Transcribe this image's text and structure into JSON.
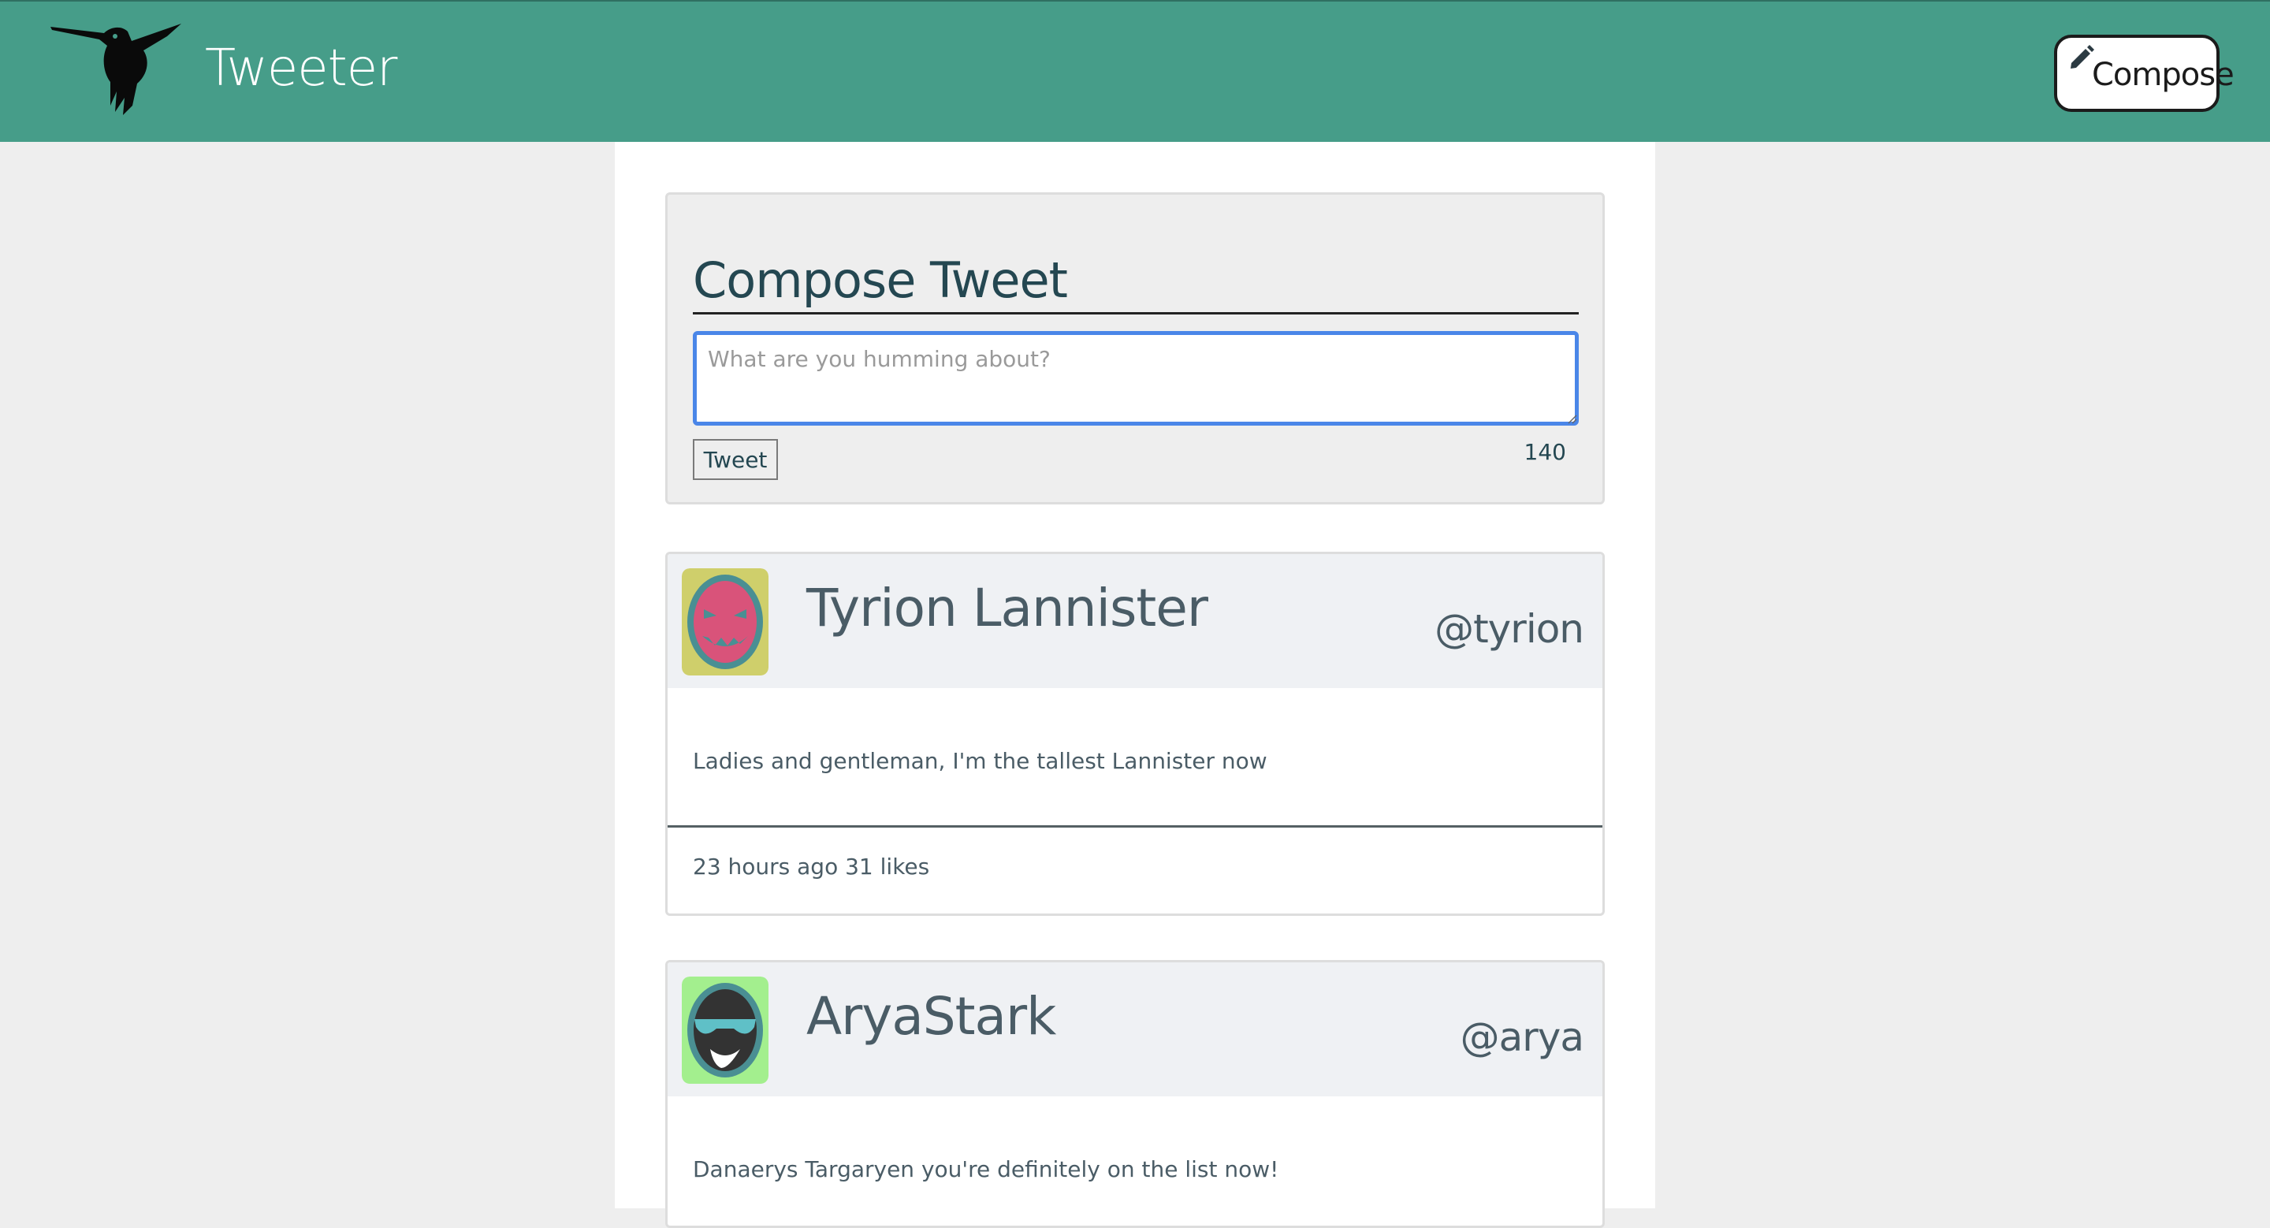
{
  "header": {
    "brand": "Tweeter",
    "compose_label": "Compose",
    "bg_color": "#469d89"
  },
  "compose": {
    "title": "Compose Tweet",
    "placeholder": "What are you humming about?",
    "submit_label": "Tweet",
    "counter": "140"
  },
  "tweets": [
    {
      "name": "Tyrion Lannister",
      "handle": "@tyrion",
      "text": "Ladies and gentleman, I'm the tallest Lannister now",
      "meta": "23 hours ago 31 likes",
      "avatar_icon": "grinning-pink-face-avatar"
    },
    {
      "name": "AryaStark",
      "handle": "@arya",
      "text": "Danaerys Targaryen you're definitely on the list now!",
      "meta": "",
      "avatar_icon": "sunglasses-dark-face-avatar"
    }
  ]
}
